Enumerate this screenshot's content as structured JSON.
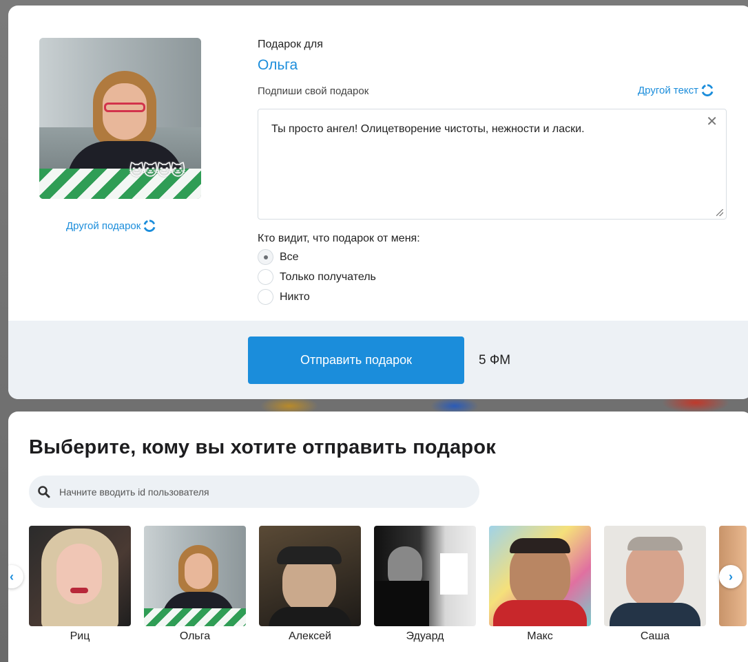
{
  "gift": {
    "for_label": "Подарок для",
    "recipient": "Ольга",
    "other_gift_label": "Другой подарок",
    "sign_label": "Подпиши свой подарок",
    "other_text_label": "Другой текст",
    "message": "Ты просто ангел! Олицетворение чистоты, нежности и ласки."
  },
  "visibility": {
    "label": "Кто видит, что подарок от меня:",
    "options": [
      {
        "label": "Все",
        "checked": true
      },
      {
        "label": "Только получатель",
        "checked": false
      },
      {
        "label": "Никто",
        "checked": false
      }
    ]
  },
  "send": {
    "button_label": "Отправить подарок",
    "price": "5 ФМ"
  },
  "recipients": {
    "title": "Выберите, кому вы хотите отправить подарок",
    "search_placeholder": "Начните вводить id пользователя",
    "friends": [
      {
        "name": "Риц"
      },
      {
        "name": "Ольга"
      },
      {
        "name": "Алексей"
      },
      {
        "name": "Эдуард"
      },
      {
        "name": "Макс"
      },
      {
        "name": "Саша"
      }
    ]
  },
  "colors": {
    "accent": "#1b8ddb",
    "band": "#edf1f5"
  }
}
